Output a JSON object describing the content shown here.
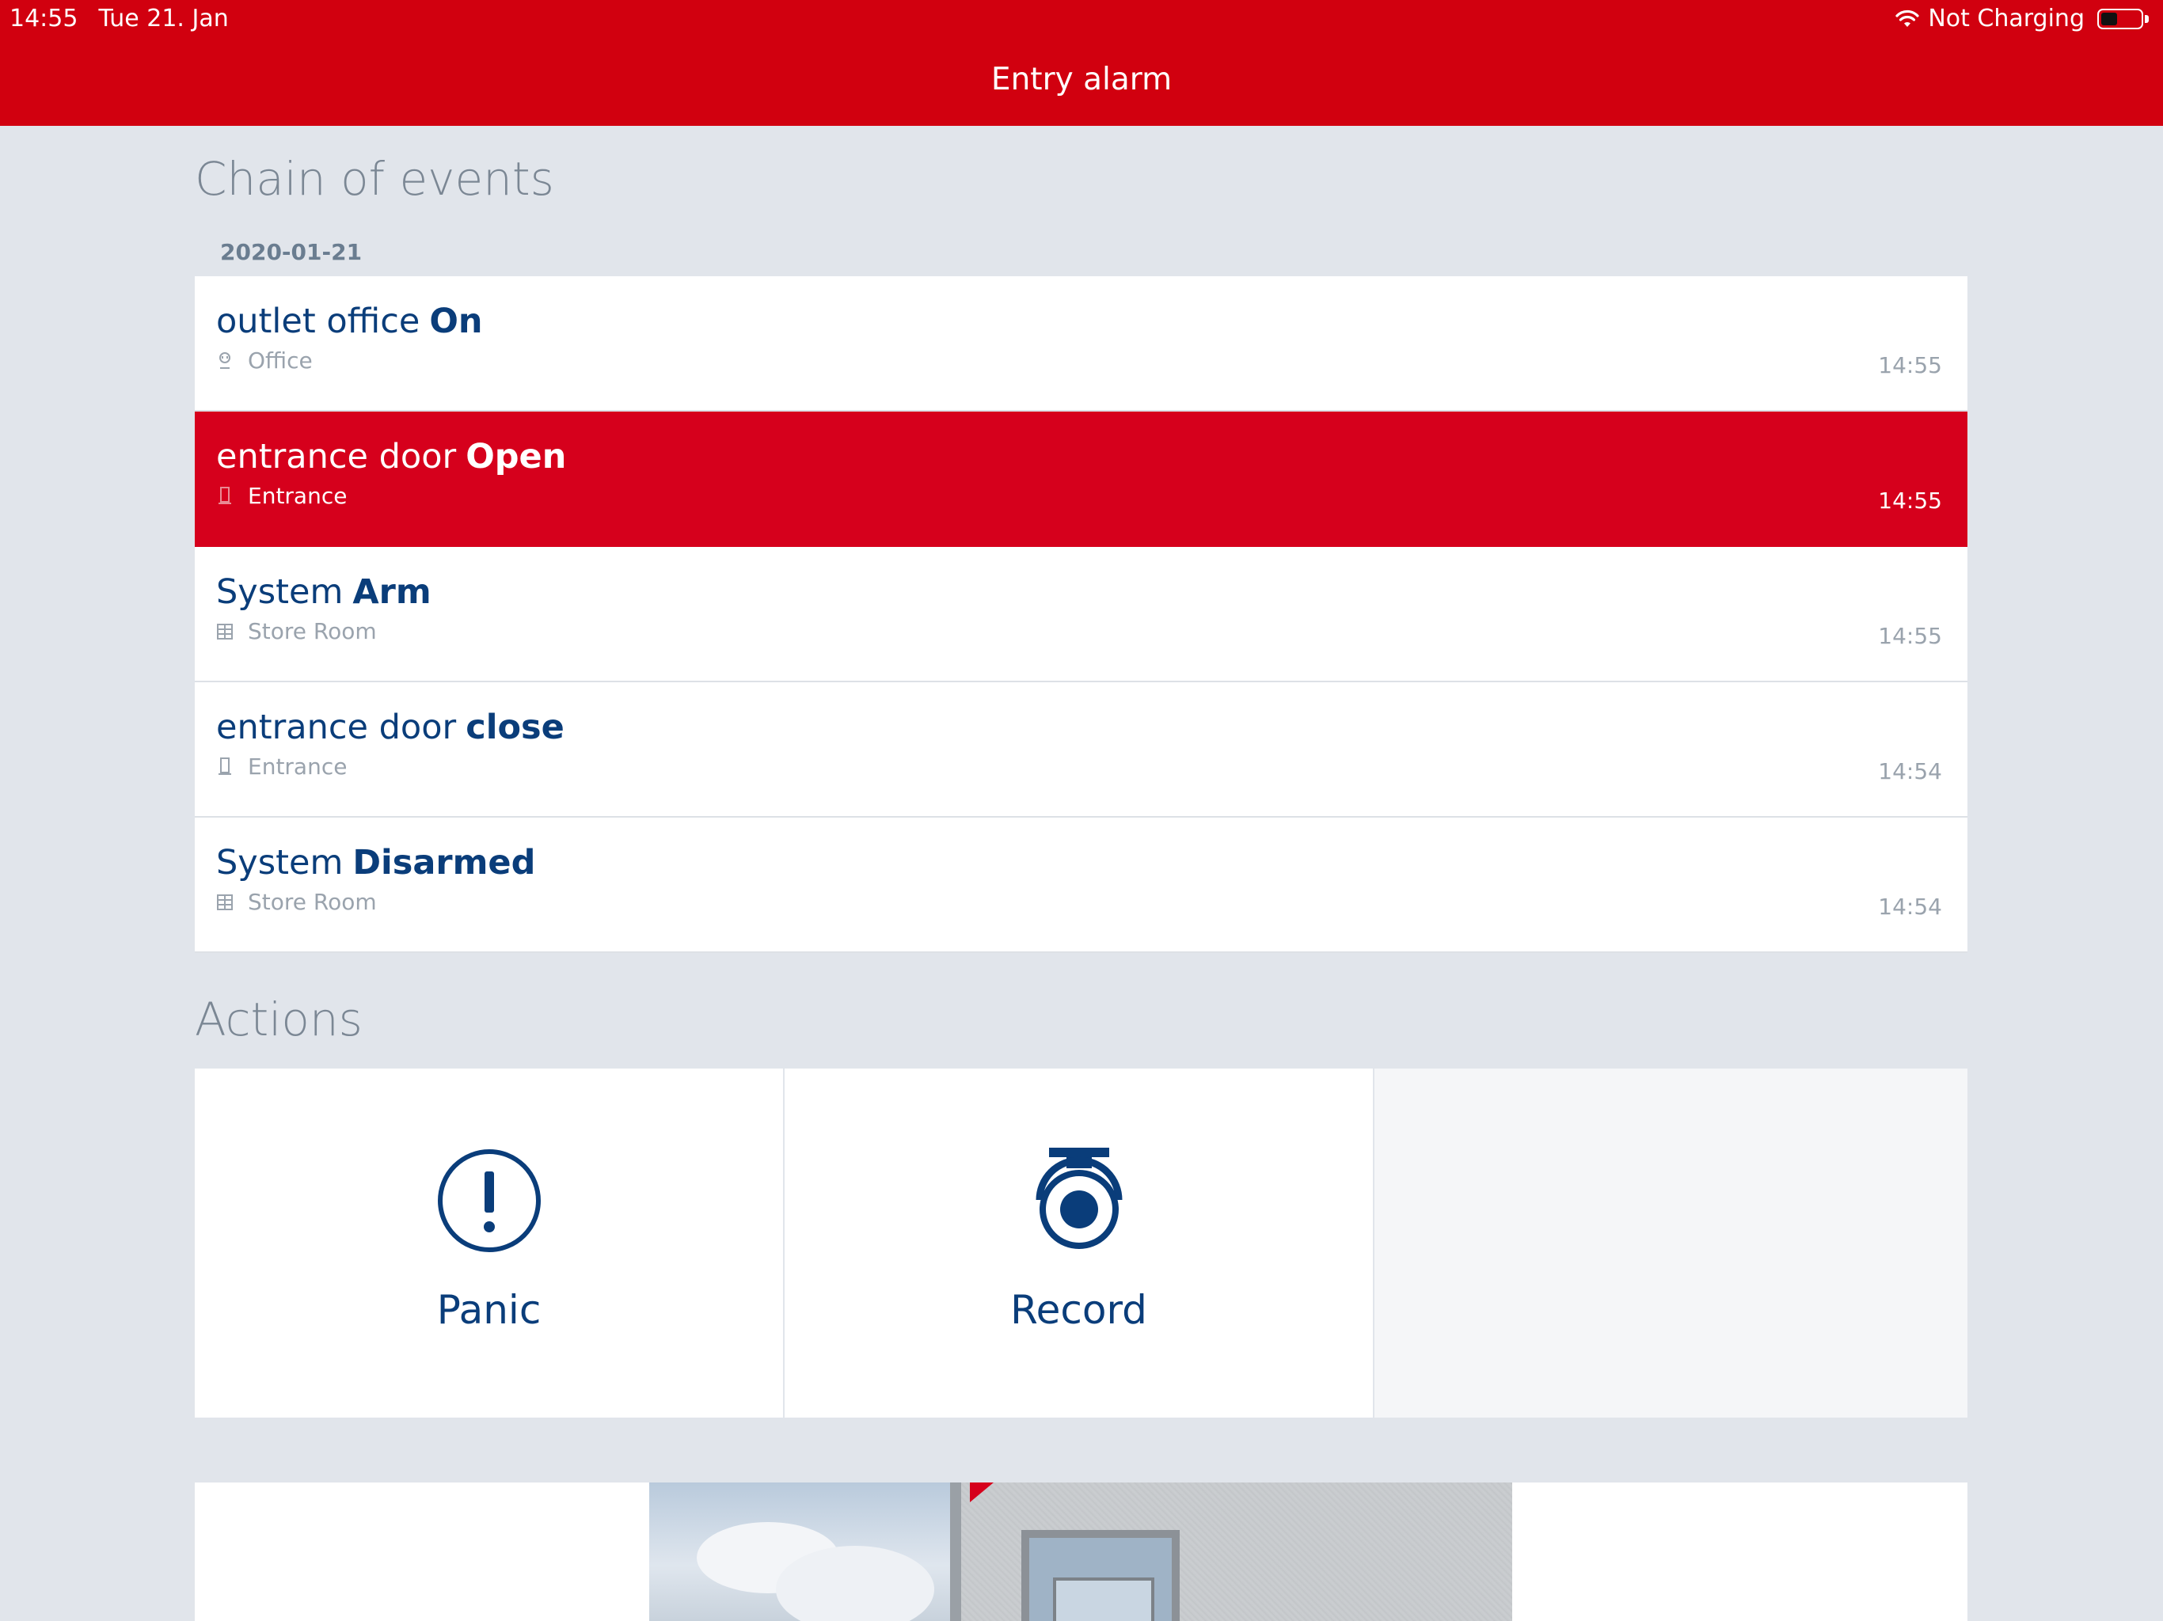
{
  "status_bar": {
    "time": "14:55",
    "date": "Tue 21. Jan",
    "charging": "Not Charging"
  },
  "nav": {
    "title": "Entry alarm"
  },
  "chain": {
    "title": "Chain of events",
    "date": "2020-01-21",
    "events": [
      {
        "name": "outlet office",
        "state": "On",
        "room": "Office",
        "time": "14:55",
        "room_icon": "outlet-icon",
        "alarm": false
      },
      {
        "name": "entrance door",
        "state": "Open",
        "room": "Entrance",
        "time": "14:55",
        "room_icon": "door-sensor-icon",
        "alarm": true
      },
      {
        "name": "System",
        "state": "Arm",
        "room": "Store Room",
        "time": "14:55",
        "room_icon": "store-room-icon",
        "alarm": false
      },
      {
        "name": "entrance door",
        "state": "close",
        "room": "Entrance",
        "time": "14:54",
        "room_icon": "door-sensor-icon",
        "alarm": false
      },
      {
        "name": "System",
        "state": "Disarmed",
        "room": "Store Room",
        "time": "14:54",
        "room_icon": "store-room-icon",
        "alarm": false
      }
    ]
  },
  "actions": {
    "title": "Actions",
    "items": [
      {
        "label": "Panic",
        "icon": "panic-icon"
      },
      {
        "label": "Record",
        "icon": "camera-icon"
      }
    ]
  },
  "colors": {
    "brand_red": "#d1000f",
    "alarm_red": "#d6001c",
    "text_blue": "#0a3d7a",
    "background": "#e1e5eb"
  }
}
